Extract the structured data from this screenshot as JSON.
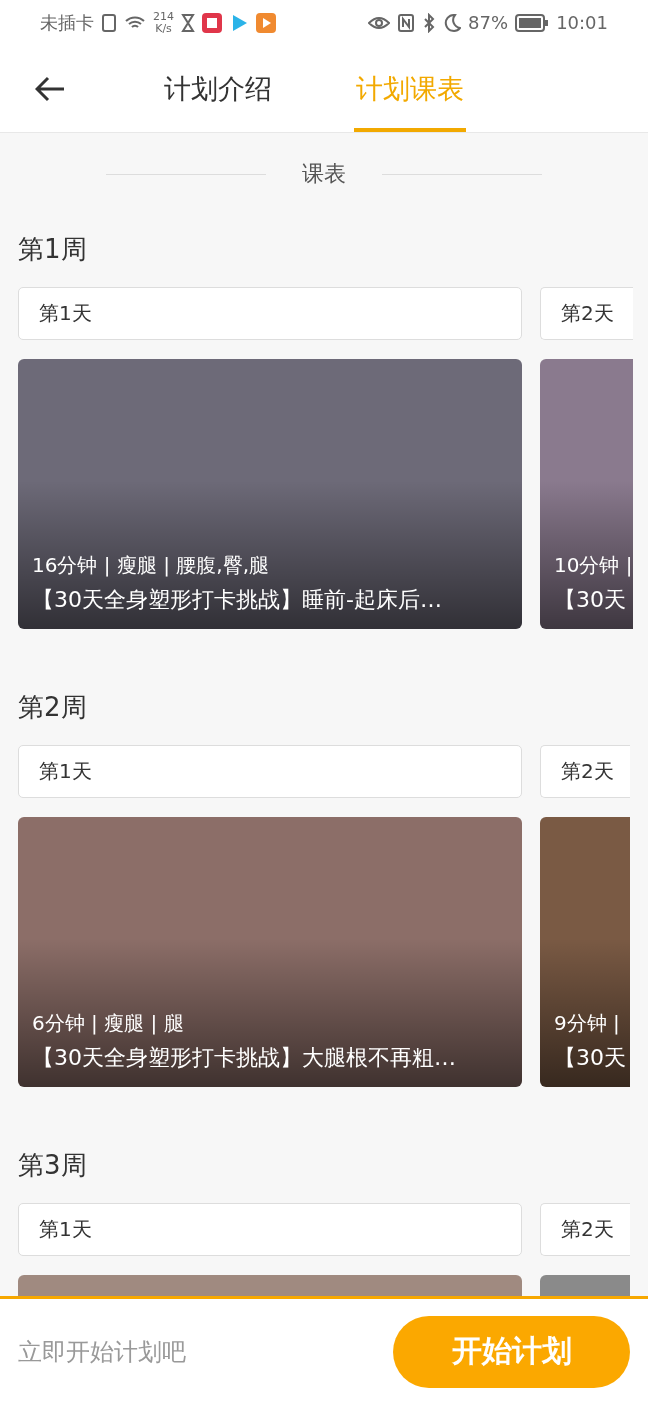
{
  "status_bar": {
    "carrier": "未插卡",
    "speed": "214",
    "speed_unit": "K/s",
    "battery": "87%",
    "time": "10:01"
  },
  "nav": {
    "tabs": [
      {
        "label": "计划介绍",
        "selected": false
      },
      {
        "label": "计划课表",
        "selected": true
      }
    ]
  },
  "section_title": "课表",
  "weeks": [
    {
      "title": "第1周",
      "days": [
        {
          "label": "第1天",
          "meta": "16分钟 | 瘦腿 | 腰腹,臀,腿",
          "course": "【30天全身塑形打卡挑战】睡前-起床后…"
        },
        {
          "label": "第2天",
          "meta": "10分钟 |",
          "course": "【30天"
        }
      ]
    },
    {
      "title": "第2周",
      "days": [
        {
          "label": "第1天",
          "meta": "6分钟 | 瘦腿 | 腿",
          "course": "【30天全身塑形打卡挑战】大腿根不再粗…"
        },
        {
          "label": "第2天",
          "meta": "9分钟 |",
          "course": "【30天"
        }
      ]
    },
    {
      "title": "第3周",
      "days": [
        {
          "label": "第1天"
        },
        {
          "label": "第2天"
        }
      ]
    }
  ],
  "footer": {
    "prompt": "立即开始计划吧",
    "button": "开始计划"
  }
}
